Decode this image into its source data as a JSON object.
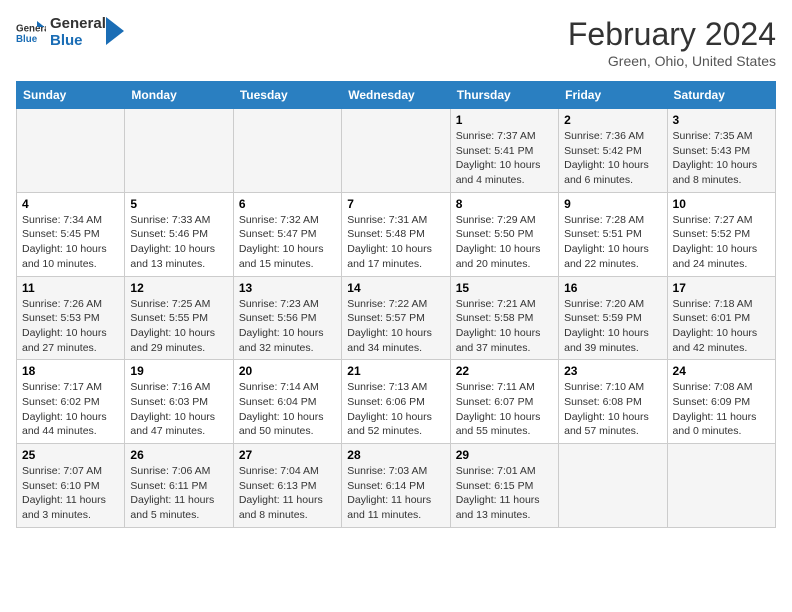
{
  "header": {
    "logo_line1": "General",
    "logo_line2": "Blue",
    "month": "February 2024",
    "location": "Green, Ohio, United States"
  },
  "weekdays": [
    "Sunday",
    "Monday",
    "Tuesday",
    "Wednesday",
    "Thursday",
    "Friday",
    "Saturday"
  ],
  "weeks": [
    [
      {
        "day": "",
        "info": ""
      },
      {
        "day": "",
        "info": ""
      },
      {
        "day": "",
        "info": ""
      },
      {
        "day": "",
        "info": ""
      },
      {
        "day": "1",
        "info": "Sunrise: 7:37 AM\nSunset: 5:41 PM\nDaylight: 10 hours\nand 4 minutes."
      },
      {
        "day": "2",
        "info": "Sunrise: 7:36 AM\nSunset: 5:42 PM\nDaylight: 10 hours\nand 6 minutes."
      },
      {
        "day": "3",
        "info": "Sunrise: 7:35 AM\nSunset: 5:43 PM\nDaylight: 10 hours\nand 8 minutes."
      }
    ],
    [
      {
        "day": "4",
        "info": "Sunrise: 7:34 AM\nSunset: 5:45 PM\nDaylight: 10 hours\nand 10 minutes."
      },
      {
        "day": "5",
        "info": "Sunrise: 7:33 AM\nSunset: 5:46 PM\nDaylight: 10 hours\nand 13 minutes."
      },
      {
        "day": "6",
        "info": "Sunrise: 7:32 AM\nSunset: 5:47 PM\nDaylight: 10 hours\nand 15 minutes."
      },
      {
        "day": "7",
        "info": "Sunrise: 7:31 AM\nSunset: 5:48 PM\nDaylight: 10 hours\nand 17 minutes."
      },
      {
        "day": "8",
        "info": "Sunrise: 7:29 AM\nSunset: 5:50 PM\nDaylight: 10 hours\nand 20 minutes."
      },
      {
        "day": "9",
        "info": "Sunrise: 7:28 AM\nSunset: 5:51 PM\nDaylight: 10 hours\nand 22 minutes."
      },
      {
        "day": "10",
        "info": "Sunrise: 7:27 AM\nSunset: 5:52 PM\nDaylight: 10 hours\nand 24 minutes."
      }
    ],
    [
      {
        "day": "11",
        "info": "Sunrise: 7:26 AM\nSunset: 5:53 PM\nDaylight: 10 hours\nand 27 minutes."
      },
      {
        "day": "12",
        "info": "Sunrise: 7:25 AM\nSunset: 5:55 PM\nDaylight: 10 hours\nand 29 minutes."
      },
      {
        "day": "13",
        "info": "Sunrise: 7:23 AM\nSunset: 5:56 PM\nDaylight: 10 hours\nand 32 minutes."
      },
      {
        "day": "14",
        "info": "Sunrise: 7:22 AM\nSunset: 5:57 PM\nDaylight: 10 hours\nand 34 minutes."
      },
      {
        "day": "15",
        "info": "Sunrise: 7:21 AM\nSunset: 5:58 PM\nDaylight: 10 hours\nand 37 minutes."
      },
      {
        "day": "16",
        "info": "Sunrise: 7:20 AM\nSunset: 5:59 PM\nDaylight: 10 hours\nand 39 minutes."
      },
      {
        "day": "17",
        "info": "Sunrise: 7:18 AM\nSunset: 6:01 PM\nDaylight: 10 hours\nand 42 minutes."
      }
    ],
    [
      {
        "day": "18",
        "info": "Sunrise: 7:17 AM\nSunset: 6:02 PM\nDaylight: 10 hours\nand 44 minutes."
      },
      {
        "day": "19",
        "info": "Sunrise: 7:16 AM\nSunset: 6:03 PM\nDaylight: 10 hours\nand 47 minutes."
      },
      {
        "day": "20",
        "info": "Sunrise: 7:14 AM\nSunset: 6:04 PM\nDaylight: 10 hours\nand 50 minutes."
      },
      {
        "day": "21",
        "info": "Sunrise: 7:13 AM\nSunset: 6:06 PM\nDaylight: 10 hours\nand 52 minutes."
      },
      {
        "day": "22",
        "info": "Sunrise: 7:11 AM\nSunset: 6:07 PM\nDaylight: 10 hours\nand 55 minutes."
      },
      {
        "day": "23",
        "info": "Sunrise: 7:10 AM\nSunset: 6:08 PM\nDaylight: 10 hours\nand 57 minutes."
      },
      {
        "day": "24",
        "info": "Sunrise: 7:08 AM\nSunset: 6:09 PM\nDaylight: 11 hours\nand 0 minutes."
      }
    ],
    [
      {
        "day": "25",
        "info": "Sunrise: 7:07 AM\nSunset: 6:10 PM\nDaylight: 11 hours\nand 3 minutes."
      },
      {
        "day": "26",
        "info": "Sunrise: 7:06 AM\nSunset: 6:11 PM\nDaylight: 11 hours\nand 5 minutes."
      },
      {
        "day": "27",
        "info": "Sunrise: 7:04 AM\nSunset: 6:13 PM\nDaylight: 11 hours\nand 8 minutes."
      },
      {
        "day": "28",
        "info": "Sunrise: 7:03 AM\nSunset: 6:14 PM\nDaylight: 11 hours\nand 11 minutes."
      },
      {
        "day": "29",
        "info": "Sunrise: 7:01 AM\nSunset: 6:15 PM\nDaylight: 11 hours\nand 13 minutes."
      },
      {
        "day": "",
        "info": ""
      },
      {
        "day": "",
        "info": ""
      }
    ]
  ]
}
